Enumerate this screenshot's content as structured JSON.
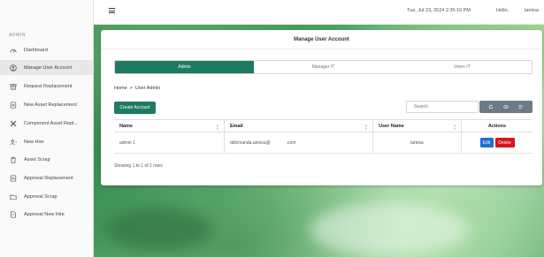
{
  "topbar": {
    "datetime": "Tue, Jul 23, 2024   2:36:16 PM",
    "hello": "Hello,",
    "username": "lamisa"
  },
  "sidebar": {
    "heading": "ADMIN",
    "items": [
      {
        "label": "Dashboard",
        "icon": "dashboard-icon"
      },
      {
        "label": "Manage User Account",
        "icon": "user-account-icon"
      },
      {
        "label": "Request Replacement",
        "icon": "request-icon"
      },
      {
        "label": "New Asset Replacement",
        "icon": "new-asset-icon"
      },
      {
        "label": "Component Asset Repl...",
        "icon": "component-icon"
      },
      {
        "label": "New Hire",
        "icon": "new-hire-icon"
      },
      {
        "label": "Asset Scrap",
        "icon": "trash-icon"
      },
      {
        "label": "Approval Replacement",
        "icon": "approval-icon"
      },
      {
        "label": "Approval Scrap",
        "icon": "folder-icon"
      },
      {
        "label": "Approval New Hire",
        "icon": "document-icon"
      }
    ]
  },
  "card": {
    "title": "Manage User Account",
    "tabs": [
      {
        "label": "Admin",
        "active": true
      },
      {
        "label": "Manager IT",
        "active": false
      },
      {
        "label": "Intern IT",
        "active": false
      }
    ],
    "breadcrumb": {
      "home": "Home",
      "sep": ">",
      "current": "User Admin"
    },
    "create_button": "Create Account",
    "search_placeholder": "Search",
    "table": {
      "headers": [
        "Name",
        "Email",
        "User Name",
        "Actions"
      ],
      "rows": [
        {
          "name": "admin 1",
          "email_start": "dzikrnanda.annisa@",
          "email_end": ".com",
          "username": "lamisa",
          "edit": "Edit",
          "delete": "Delete"
        }
      ]
    },
    "showing": "Showing 1 to 1 of 1 rows"
  },
  "colors": {
    "primary": "#1e7b62",
    "edit": "#1e6fd2",
    "delete": "#d9141b",
    "toolbar": "#6c7c86"
  }
}
